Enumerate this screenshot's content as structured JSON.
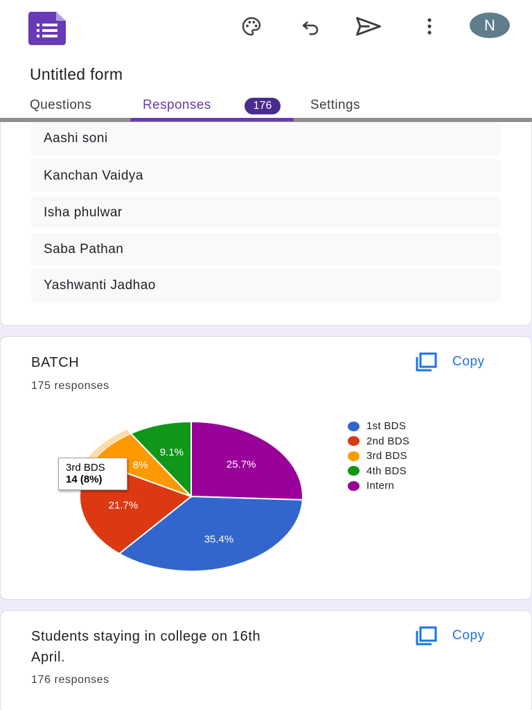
{
  "form": {
    "title": "Untitled form",
    "avatar_initial": "N"
  },
  "tabs": [
    {
      "label": "Questions"
    },
    {
      "label": "Responses",
      "badge": "176"
    },
    {
      "label": "Settings"
    }
  ],
  "response_list": [
    "Aashi soni",
    "Kanchan Vaidya",
    "Isha phulwar",
    "Saba Pathan",
    "Yashwanti Jadhao"
  ],
  "cards": [
    {
      "title": "BATCH",
      "responses": "175 responses",
      "copy_label": "Copy"
    },
    {
      "title_line1": "Students staying in college on 16th",
      "title_line2": "April.",
      "responses": "176 responses",
      "copy_label": "Copy"
    }
  ],
  "tooltip": {
    "label": "3rd BDS",
    "value": "14 (8%)"
  },
  "icons": [
    "forms-logo-icon",
    "palette-icon",
    "undo-icon",
    "send-icon",
    "more-vert-icon",
    "copy-icon"
  ],
  "colors": {
    "accent": "#673ab7",
    "link": "#1a73e8"
  },
  "chart_data": {
    "type": "pie",
    "title": "",
    "categories": [
      "1st BDS",
      "2nd BDS",
      "3rd BDS",
      "4th BDS",
      "Intern"
    ],
    "values": [
      35.4,
      21.7,
      8.0,
      9.1,
      25.7
    ],
    "labels": [
      "35.4%",
      "21.7%",
      "8%",
      "9.1%",
      "25.7%"
    ],
    "colors": [
      "#3366cc",
      "#dc3912",
      "#ff9900",
      "#109618",
      "#990099"
    ],
    "legend": "right",
    "highlighted": "3rd BDS"
  }
}
